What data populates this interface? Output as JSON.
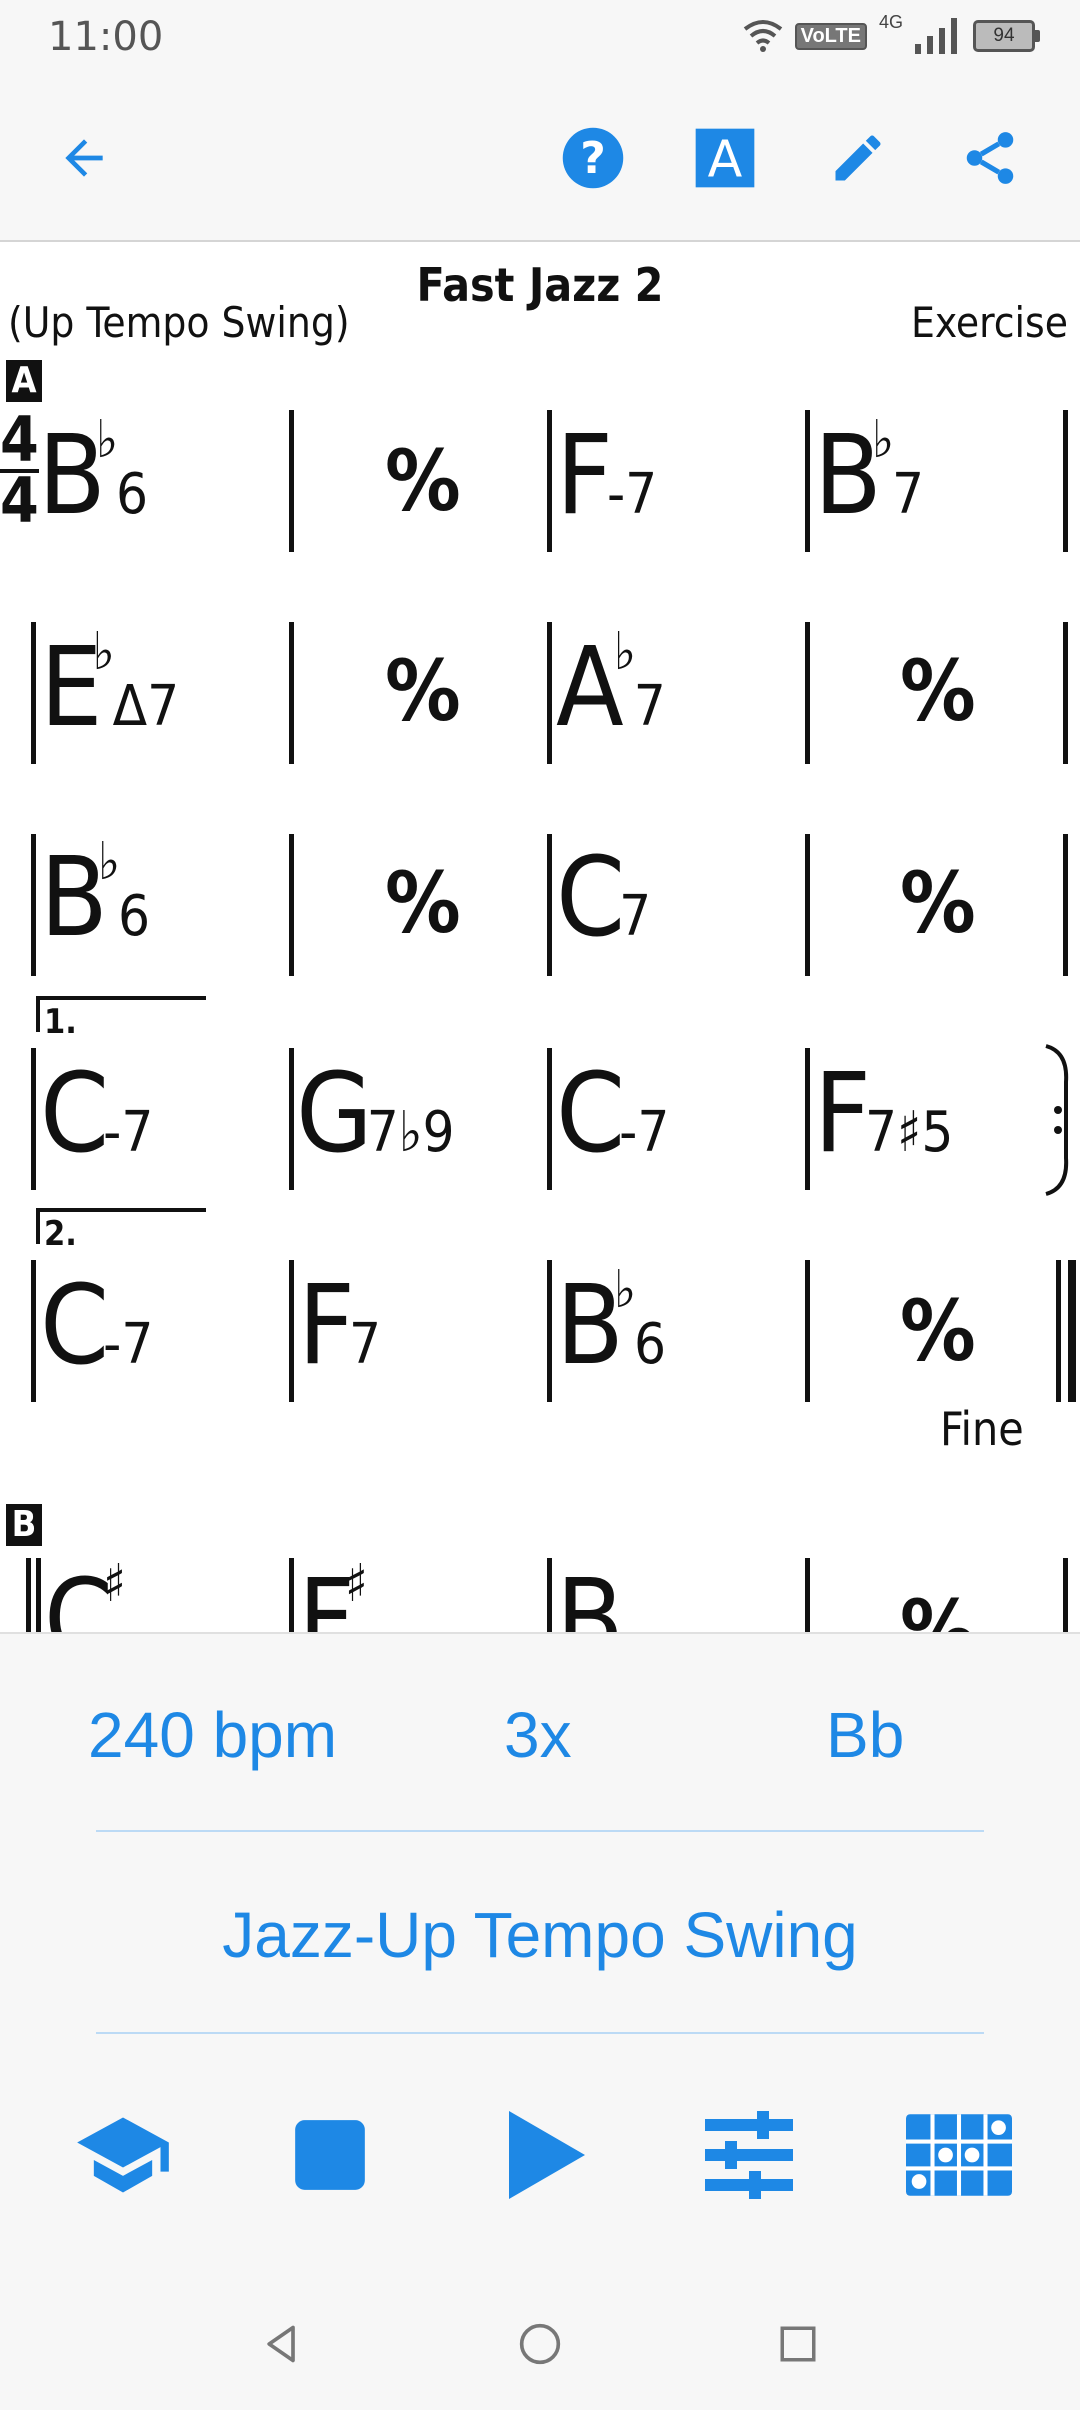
{
  "status": {
    "time": "11:00",
    "volte": "VoLTE",
    "network": "4G",
    "battery": "94"
  },
  "sheet": {
    "title": "Fast Jazz 2",
    "style": "(Up Tempo Swing)",
    "composer": "Exercise",
    "section_a": "A",
    "section_b": "B",
    "time_top": "4",
    "time_bottom": "4",
    "ending_1": "1.",
    "ending_2": "2.",
    "fine": "Fine",
    "repeat_symbol": "∕",
    "chords": {
      "r1c1_root": "B",
      "r1c1_acc": "♭",
      "r1c1_q": "6",
      "r1c3_root": "F",
      "r1c3_q": "-7",
      "r1c4_root": "B",
      "r1c4_acc": "♭",
      "r1c4_q": "7",
      "r2c1_root": "E",
      "r2c1_acc": "♭",
      "r2c1_q": "Δ7",
      "r2c3_root": "A",
      "r2c3_acc": "♭",
      "r2c3_q": "7",
      "r3c1_root": "B",
      "r3c1_acc": "♭",
      "r3c1_q": "6",
      "r3c3_root": "C",
      "r3c3_q": "7",
      "r4c1_root": "C",
      "r4c1_q": "-7",
      "r4c2_root": "G",
      "r4c2_q": "7♭9",
      "r4c3_root": "C",
      "r4c3_q": "-7",
      "r4c4_root": "F",
      "r4c4_q": "7♯5",
      "r5c1_root": "C",
      "r5c1_q": "-7",
      "r5c2_root": "F",
      "r5c2_q": "7",
      "r5c3_root": "B",
      "r5c3_acc": "♭",
      "r5c3_q": "6",
      "r6c1_root": "C",
      "r6c1_acc": "♯",
      "r6c2_root": "F",
      "r6c2_acc": "♯",
      "r6c3_root": "B"
    }
  },
  "controls": {
    "tempo": "240 bpm",
    "repeats": "3x",
    "key": "Bb",
    "style": "Jazz-Up Tempo Swing"
  },
  "icons": {
    "back": "back-arrow-icon",
    "help": "help-icon",
    "font": "font-icon",
    "edit": "pencil-icon",
    "share": "share-icon",
    "learn": "graduation-cap-icon",
    "stop": "stop-icon",
    "play": "play-icon",
    "mixer": "mixer-sliders-icon",
    "grid": "instrument-grid-icon"
  },
  "colors": {
    "accent": "#1e88e5"
  }
}
